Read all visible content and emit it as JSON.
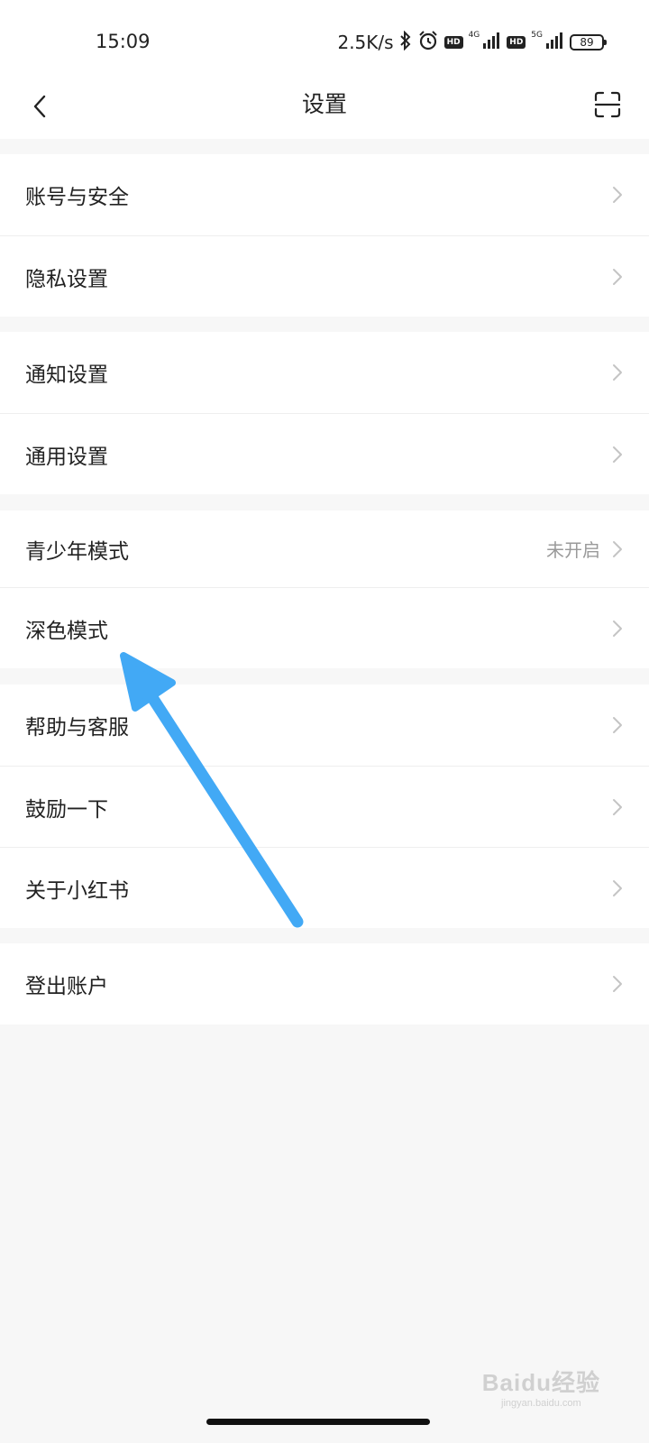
{
  "status_bar": {
    "time": "15:09",
    "net_speed": "2.5K/s",
    "hd1": "HD",
    "net1": "4G",
    "hd2": "HD",
    "net2": "5G",
    "battery": "89",
    "icons": [
      "bluetooth-icon",
      "alarm-icon",
      "signal-icon",
      "signal-icon",
      "battery-icon"
    ]
  },
  "nav": {
    "title": "设置",
    "back_icon": "chevron-left-icon",
    "scan_icon": "scan-icon"
  },
  "groups": [
    {
      "items": [
        {
          "label": "账号与安全"
        },
        {
          "label": "隐私设置"
        }
      ]
    },
    {
      "items": [
        {
          "label": "通知设置"
        },
        {
          "label": "通用设置"
        }
      ]
    },
    {
      "items": [
        {
          "label": "青少年模式",
          "value": "未开启"
        },
        {
          "label": "深色模式"
        }
      ]
    },
    {
      "items": [
        {
          "label": "帮助与客服"
        },
        {
          "label": "鼓励一下"
        },
        {
          "label": "关于小红书"
        }
      ]
    },
    {
      "items": [
        {
          "label": "登出账户"
        }
      ]
    }
  ],
  "annotation": {
    "type": "arrow",
    "color": "#42a9f5",
    "points_to": "深色模式"
  },
  "watermark": {
    "logo": "Baidu经验",
    "url": "jingyan.baidu.com"
  },
  "colors": {
    "background": "#f7f7f7",
    "card": "#ffffff",
    "secondary_text": "#9a9a9a",
    "chevron": "#c4c4c4"
  }
}
